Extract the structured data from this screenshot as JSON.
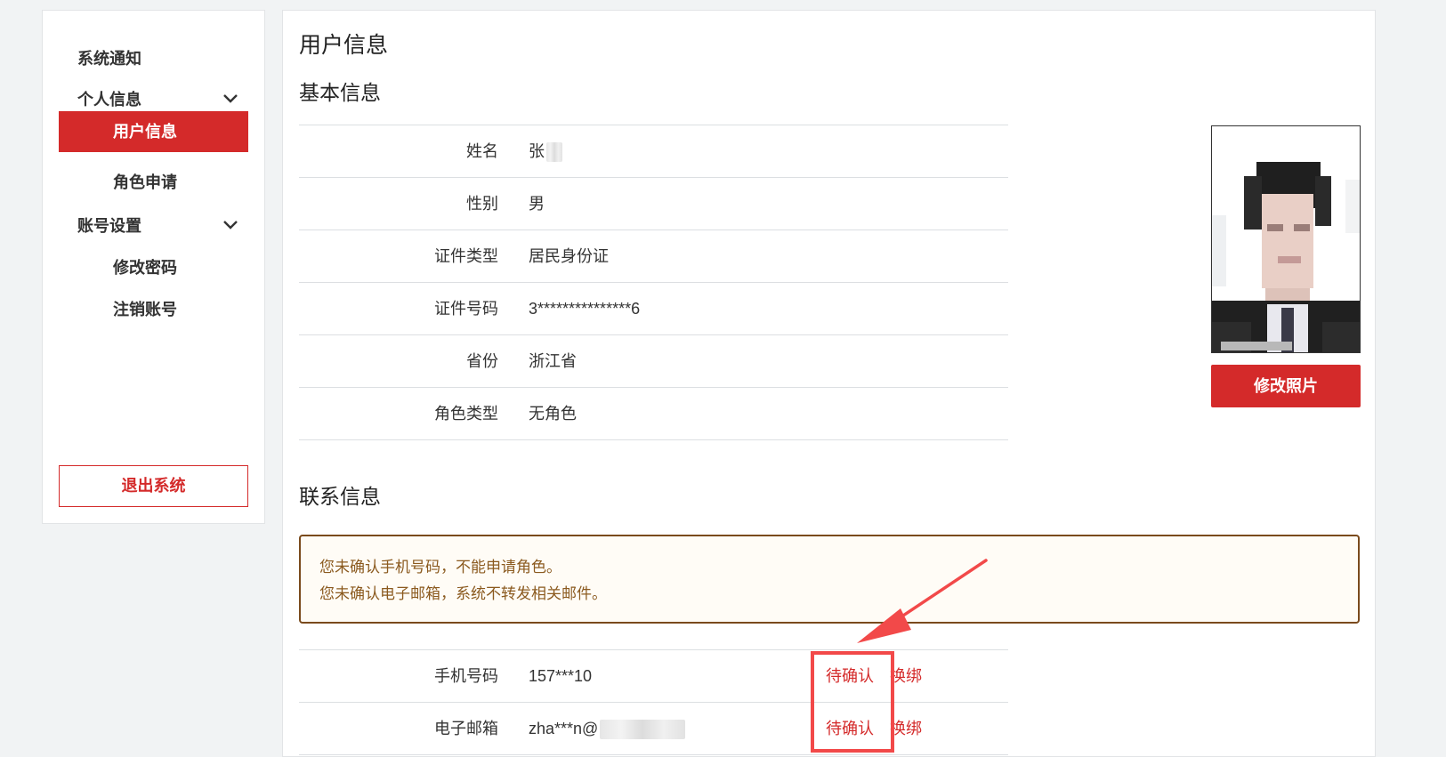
{
  "sidebar": {
    "items": [
      {
        "label": "系统通知"
      },
      {
        "label": "个人信息"
      },
      {
        "label": "用户信息"
      },
      {
        "label": "角色申请"
      },
      {
        "label": "账号设置"
      },
      {
        "label": "修改密码"
      },
      {
        "label": "注销账号"
      }
    ],
    "logout_label": "退出系统"
  },
  "main": {
    "page_title": "用户信息",
    "basic_section": {
      "title": "基本信息",
      "rows": [
        {
          "label": "姓名",
          "value": "张"
        },
        {
          "label": "性别",
          "value": "男"
        },
        {
          "label": "证件类型",
          "value": "居民身份证"
        },
        {
          "label": "证件号码",
          "value": "3***************6"
        },
        {
          "label": "省份",
          "value": "浙江省"
        },
        {
          "label": "角色类型",
          "value": "无角色"
        }
      ]
    },
    "photo": {
      "button_label": "修改照片"
    },
    "contact_section": {
      "title": "联系信息",
      "alert_lines": [
        "您未确认手机号码，不能申请角色。",
        "您未确认电子邮箱，系统不转发相关邮件。"
      ],
      "rows": [
        {
          "label": "手机号码",
          "value": "157***10",
          "confirm": "待确认",
          "rebind": "换绑"
        },
        {
          "label": "电子邮箱",
          "value": "zha***n@",
          "confirm": "待确认",
          "rebind": "换绑"
        }
      ]
    }
  },
  "colors": {
    "accent": "#d42a2a",
    "alert_border": "#7a4a1c",
    "alert_text": "#8b5a1f",
    "annotation": "#f24949"
  },
  "icons": {
    "expand": "chevron-down-icon"
  }
}
